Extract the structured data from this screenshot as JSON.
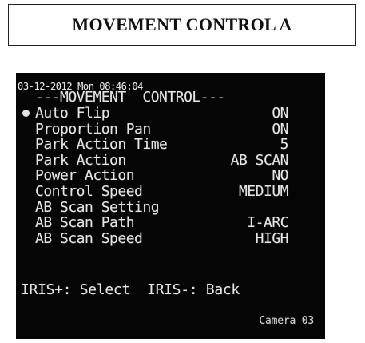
{
  "header": {
    "title": "MOVEMENT CONTROL A"
  },
  "osd": {
    "timestamp": "03-12-2012 Mon 08:46:04",
    "menu_title": "---MOVEMENT  CONTROL---",
    "items": [
      {
        "label": "Auto Flip",
        "value": "ON",
        "selected": true
      },
      {
        "label": "Proportion Pan",
        "value": "ON",
        "selected": false
      },
      {
        "label": "Park Action Time",
        "value": "5",
        "selected": false
      },
      {
        "label": "Park Action",
        "value": "AB SCAN",
        "selected": false
      },
      {
        "label": "Power Action",
        "value": "NO",
        "selected": false
      },
      {
        "label": "Control Speed",
        "value": "MEDIUM",
        "selected": false
      },
      {
        "label": "AB Scan Setting",
        "value": "",
        "selected": false
      },
      {
        "label": "AB Scan Path",
        "value": "I-ARC",
        "selected": false
      },
      {
        "label": "AB Scan Speed",
        "value": "HIGH",
        "selected": false
      }
    ],
    "footer": "IRIS+: Select  IRIS-: Back",
    "camera_label": "Camera 03"
  },
  "colors": {
    "osd_background": "#050505",
    "osd_text": "#e4e4e4"
  }
}
